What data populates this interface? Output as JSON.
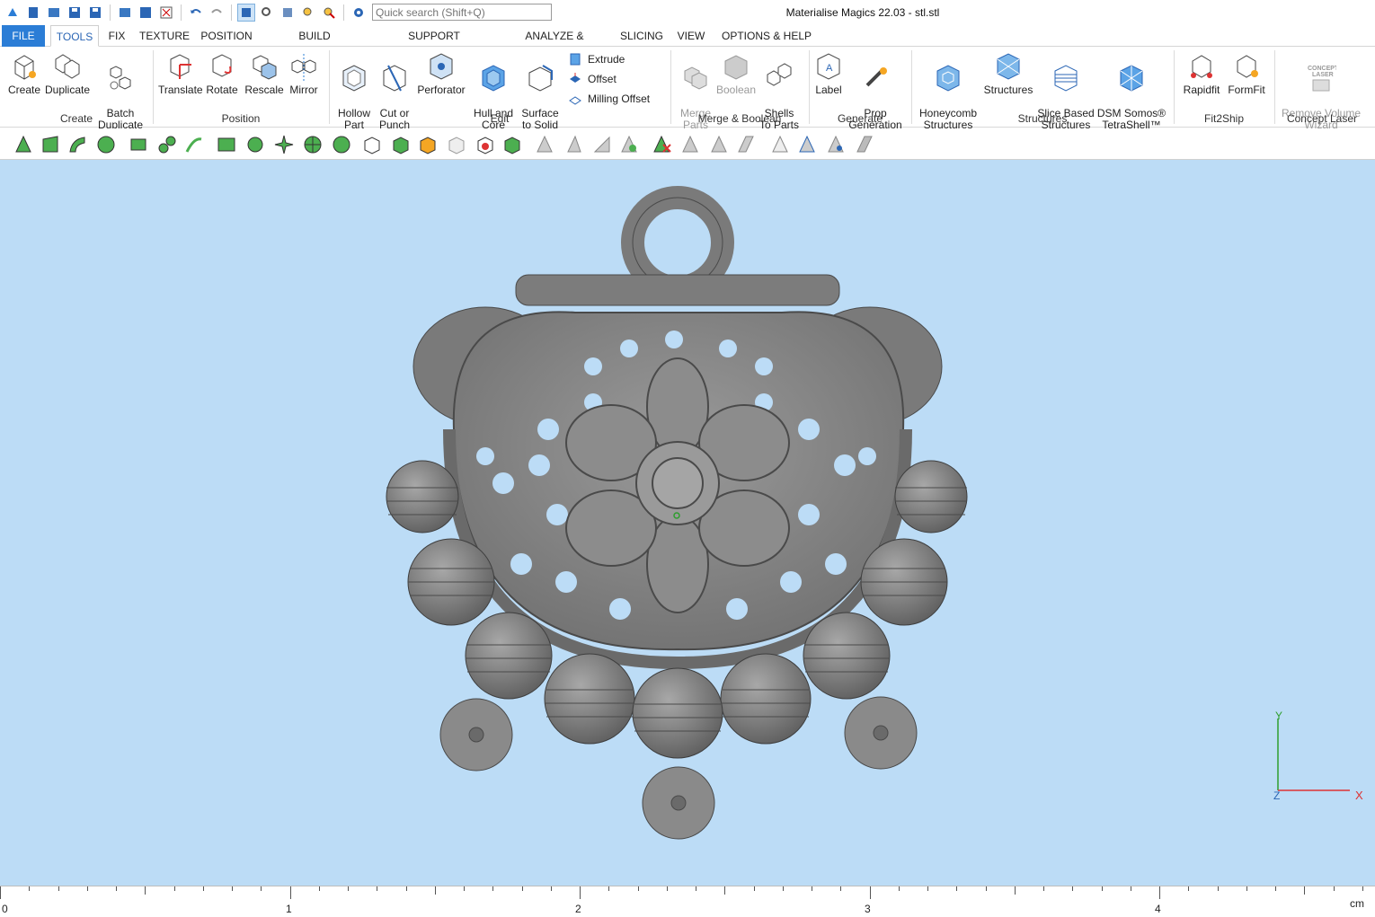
{
  "window": {
    "title": "Materialise Magics 22.03 - stl.stl"
  },
  "quick_search": {
    "placeholder": "Quick search (Shift+Q)"
  },
  "tabs": [
    "FILE",
    "TOOLS",
    "FIX",
    "TEXTURE",
    "POSITION",
    "BUILD PREPARATION",
    "SUPPORT GENERATION",
    "ANALYZE & REPORT",
    "SLICING",
    "VIEW",
    "OPTIONS & HELP"
  ],
  "active_tab": "TOOLS",
  "ribbon": {
    "create": {
      "label": "Create",
      "buttons": [
        "Create",
        "Duplicate",
        "Batch\nDuplicate"
      ]
    },
    "position": {
      "label": "Position",
      "buttons": [
        "Translate",
        "Rotate",
        "Rescale",
        "Mirror"
      ]
    },
    "edit": {
      "label": "Edit",
      "buttons": [
        "Hollow\nPart",
        "Cut or\nPunch",
        "Perforator",
        "Hull and\nCore",
        "Surface\nto Solid"
      ],
      "small": [
        "Extrude",
        "Offset",
        "Milling Offset"
      ]
    },
    "merge": {
      "label": "Merge & Boolean",
      "buttons": [
        "Merge\nParts",
        "Boolean",
        "Shells\nTo Parts"
      ]
    },
    "generate": {
      "label": "Generate",
      "buttons": [
        "Label",
        "Prop\nGeneration"
      ]
    },
    "structures": {
      "label": "Structures",
      "buttons": [
        "Honeycomb\nStructures",
        "Structures",
        "Slice Based\nStructures",
        "DSM Somos®\nTetraShell™"
      ]
    },
    "fit2ship": {
      "label": "Fit2Ship",
      "buttons": [
        "Rapidfit",
        "FormFit"
      ]
    },
    "concept": {
      "label": "Concept Laser",
      "buttons": [
        "Remove Volume\nWizard"
      ],
      "logo": "CONCEPT\nLASER"
    }
  },
  "axes": {
    "y": "Y",
    "x": "X",
    "z": "Z"
  },
  "ruler": {
    "labels": [
      "0",
      "1",
      "2",
      "3",
      "4"
    ],
    "unit": "cm"
  },
  "colors": {
    "viewport": "#bcdcf6",
    "model": "#8a8a8a",
    "accent": "#2b7dd6"
  }
}
